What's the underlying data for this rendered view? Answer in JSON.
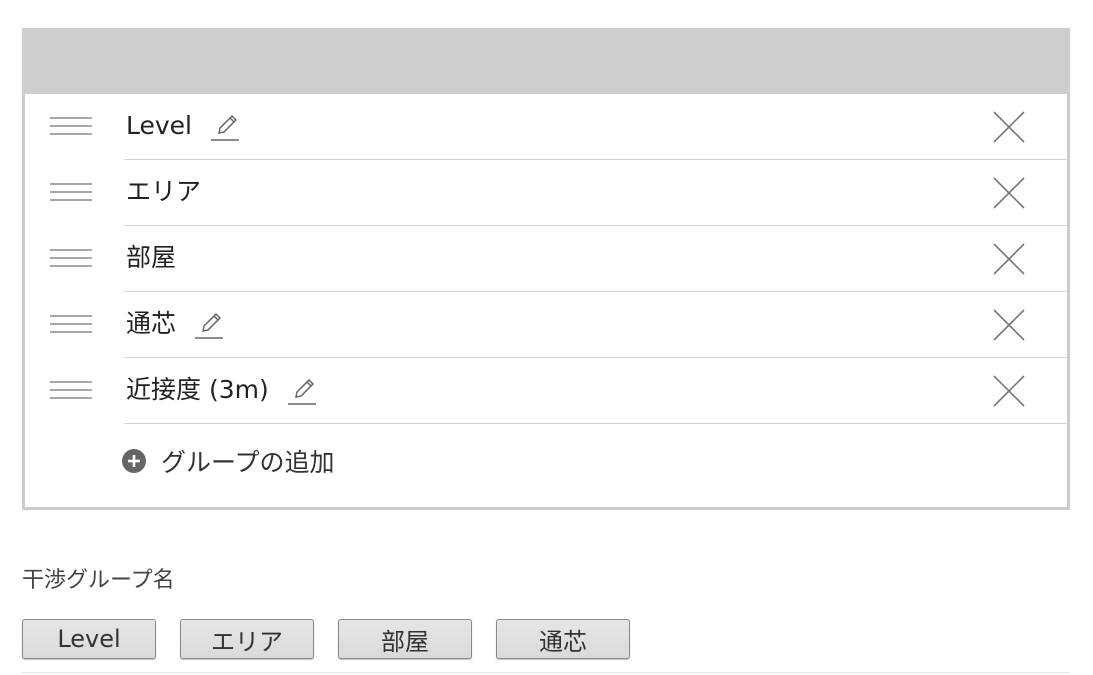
{
  "groups": {
    "items": [
      {
        "label": "Level",
        "editable": true,
        "icon": "pencil-icon"
      },
      {
        "label": "エリア",
        "editable": false
      },
      {
        "label": "部屋",
        "editable": false
      },
      {
        "label": "通芯",
        "editable": true,
        "icon": "pencil-icon"
      },
      {
        "label": "近接度 (3m)",
        "editable": true,
        "icon": "pencil-icon"
      }
    ],
    "add_label": "グループの追加",
    "header_color": "#cecece"
  },
  "interference": {
    "title": "干渉グループ名",
    "tags": [
      "Level",
      "エリア",
      "部屋",
      "通芯"
    ]
  },
  "icons": {
    "drag": "drag-handle-icon",
    "edit": "pencil-icon",
    "remove": "close-icon",
    "add": "plus-circle-icon"
  }
}
